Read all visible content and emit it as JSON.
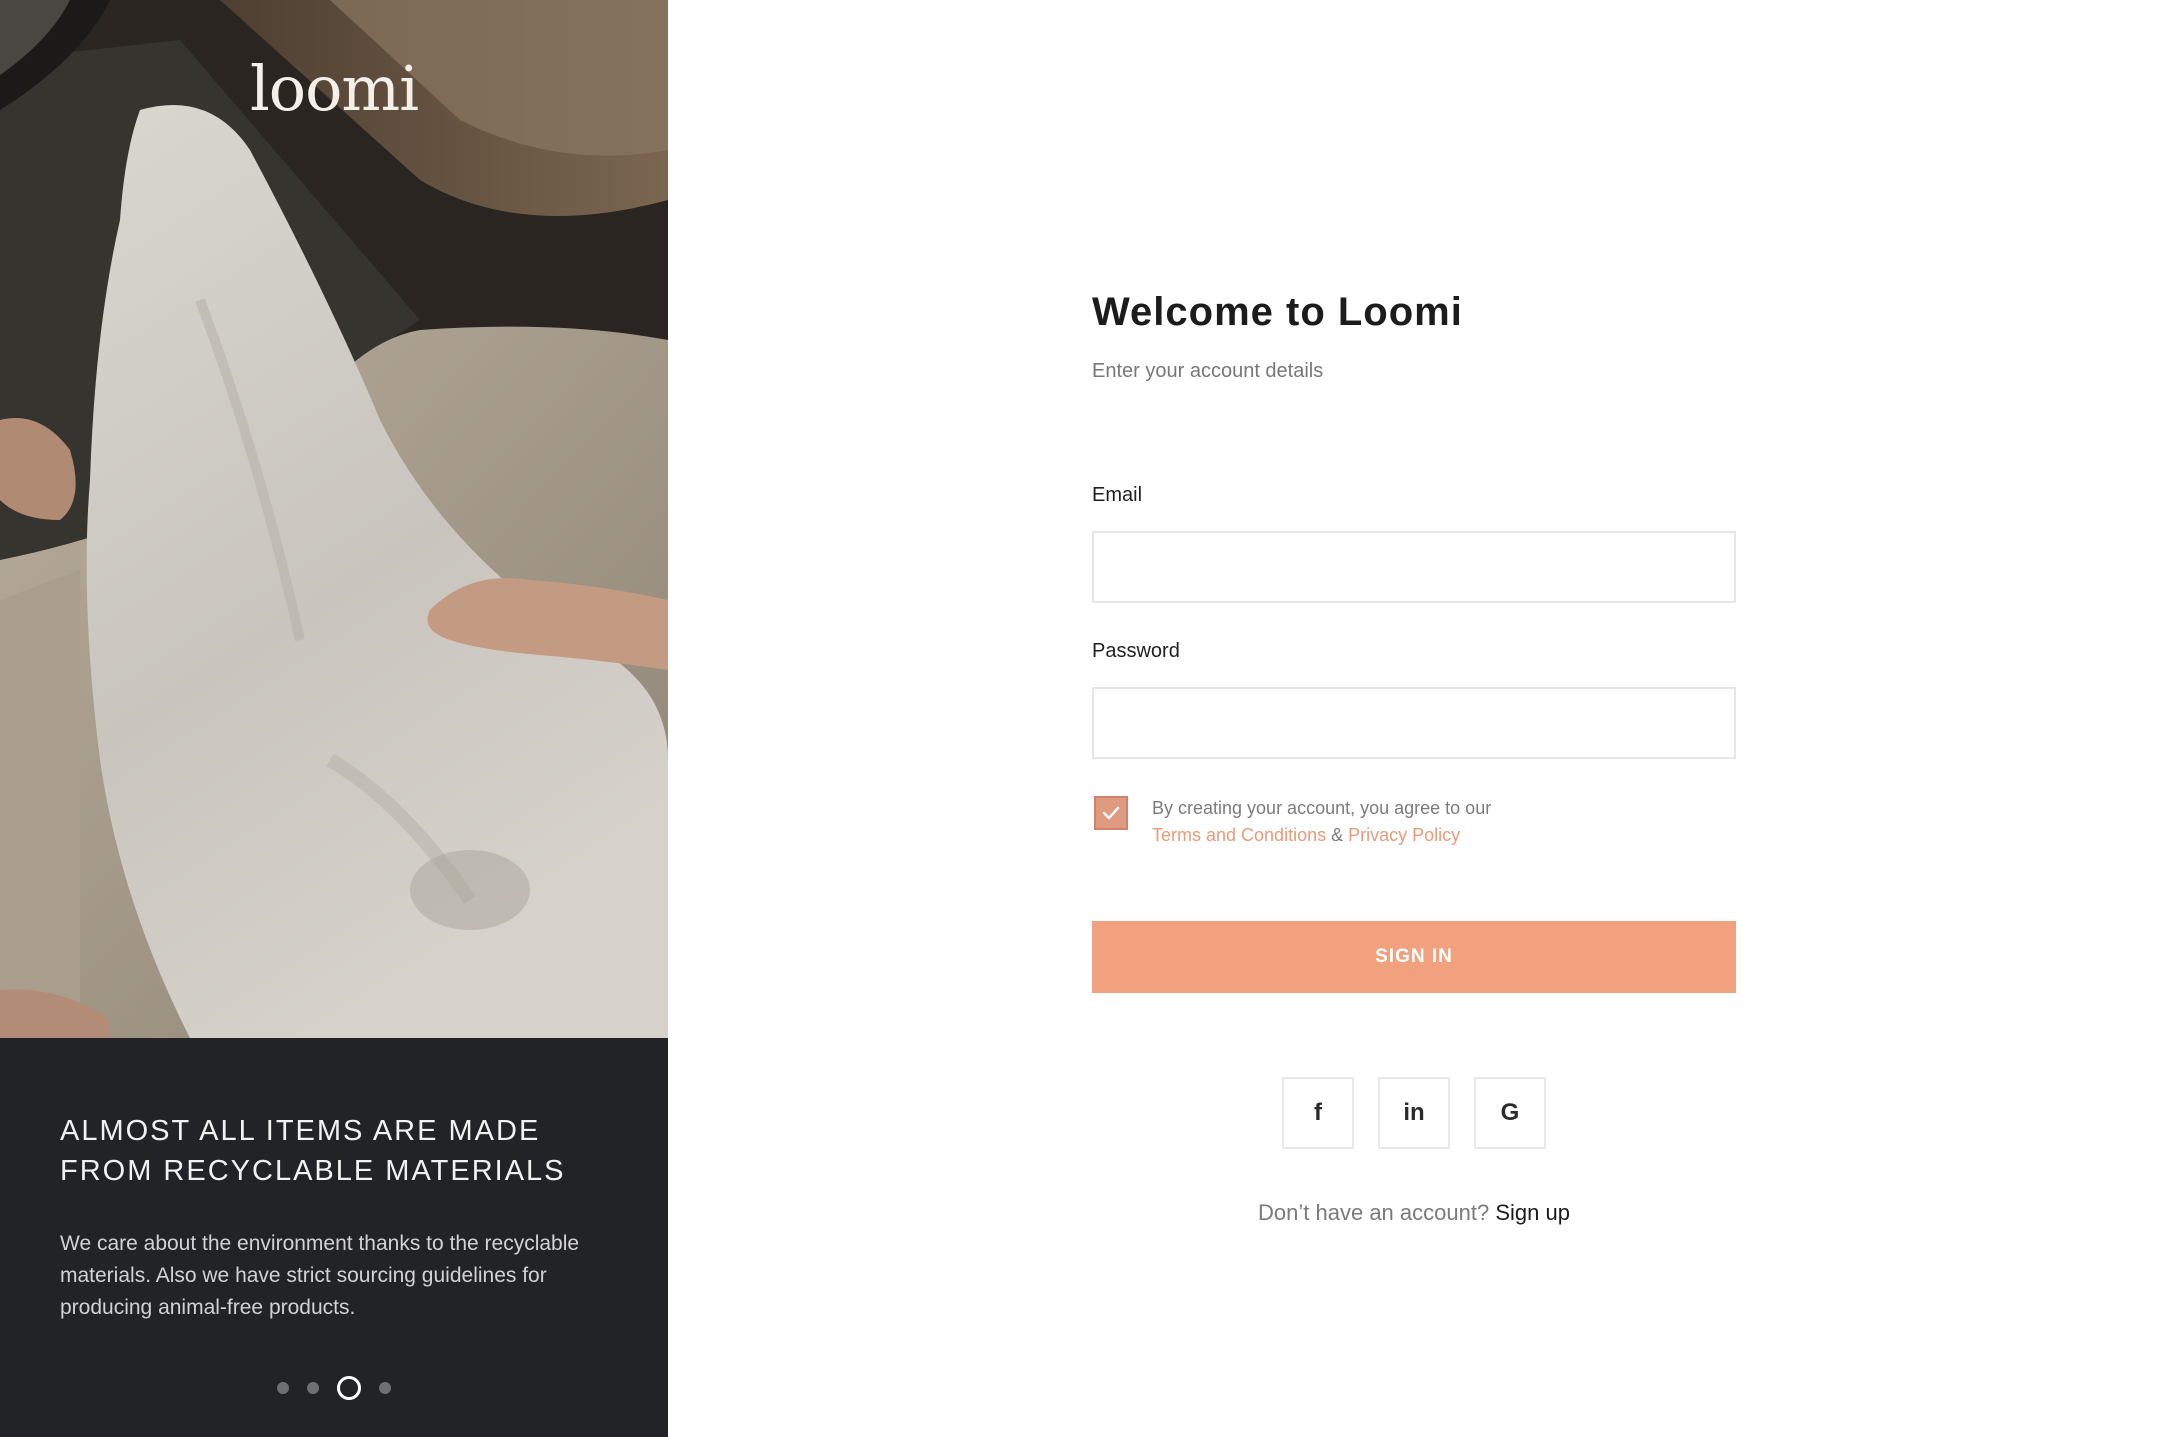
{
  "brand": {
    "logo_text": "loomi",
    "accent_color": "#F2A17F",
    "dark_panel_color": "#222326"
  },
  "left_panel": {
    "caption_title": "ALMOST ALL ITEMS ARE MADE FROM RECYCLABLE MATERIALS",
    "caption_body": "We care about the environment thanks to the recyclable materials. Also we have strict sourcing guidelines for producing animal-free products.",
    "carousel": {
      "count": 4,
      "active_index": 2
    }
  },
  "form": {
    "title": "Welcome to Loomi",
    "subtitle": "Enter your account details",
    "email_label": "Email",
    "email_value": "",
    "password_label": "Password",
    "password_value": "",
    "terms_checked": true,
    "terms_prefix": "By creating your account, you agree to our",
    "terms_link": "Terms and Conditions",
    "terms_and": "&",
    "privacy_link": "Privacy Policy",
    "sign_in_label": "SIGN IN",
    "socials": [
      {
        "name": "facebook",
        "icon": "facebook-icon",
        "glyph": "f"
      },
      {
        "name": "linkedin",
        "icon": "linkedin-icon",
        "glyph": "in"
      },
      {
        "name": "google",
        "icon": "google-icon",
        "glyph": "G"
      }
    ],
    "no_account_text": "Don’t have an account?",
    "sign_up_label": "Sign up"
  }
}
